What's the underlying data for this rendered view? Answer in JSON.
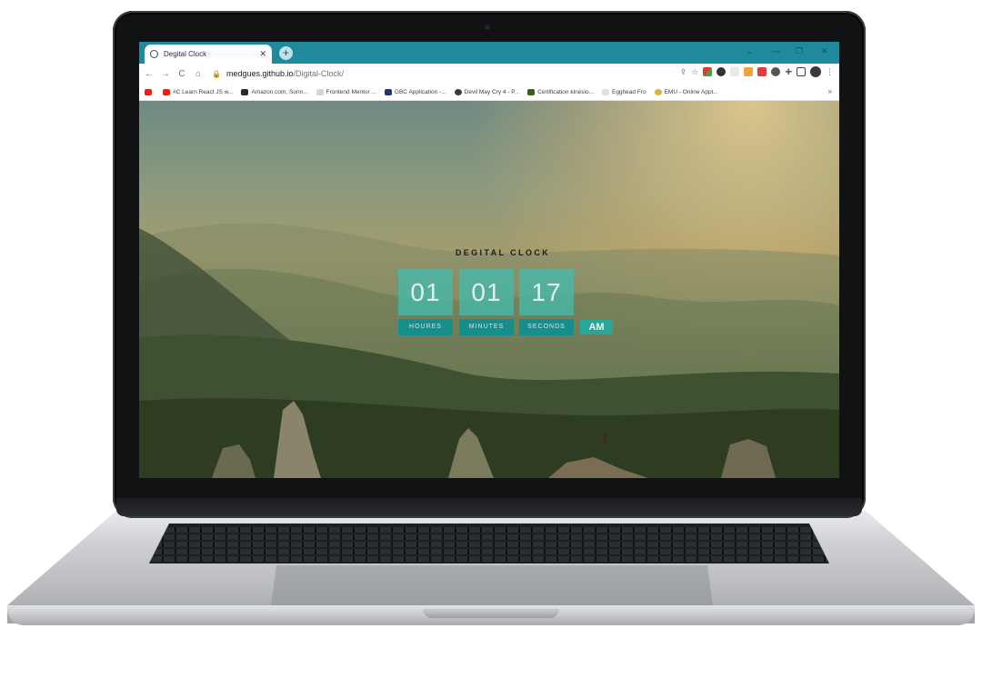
{
  "browser": {
    "tab_title": "Degital Clock",
    "tab_close": "✕",
    "new_tab": "+",
    "window_controls": [
      "⌄",
      "—",
      "❐",
      "✕"
    ],
    "nav": {
      "back": "←",
      "forward": "→",
      "reload": "C",
      "home": "⌂"
    },
    "address": {
      "lock": "🔒",
      "host": "medgues.github.io",
      "path": "/Digital-Clock/"
    },
    "toolbar_icons": [
      "share-icon",
      "star-icon",
      "extension-icons",
      "puzzle-icon",
      "sidebar-icon",
      "profile-avatar",
      "menu-icon"
    ],
    "menu_glyph": "⋮",
    "star_glyph": "☆",
    "bookmarks": [
      {
        "label": "",
        "color": "#e62117"
      },
      {
        "label": "#C Learn React JS w...",
        "color": "#e62117"
      },
      {
        "label": "Amazon.com. Sonn...",
        "color": "#2a2a2a"
      },
      {
        "label": "Frontend Mentor ...",
        "color": "#d5d5d5"
      },
      {
        "label": "GBC Application -...",
        "color": "#22356b"
      },
      {
        "label": "Devil May Cry 4 - P...",
        "color": "#3b3b3b"
      },
      {
        "label": "Certification kinésio...",
        "color": "#3b5e1c"
      },
      {
        "label": "Egghead Fro",
        "color": "#e0e0e0"
      },
      {
        "label": "EMU - Online Appl...",
        "color": "#d8b43a"
      }
    ],
    "bookmarks_more": "»"
  },
  "page": {
    "title": "DEGITAL CLOCK",
    "hours": "01",
    "minutes": "01",
    "seconds": "17",
    "hours_label": "HOURES",
    "minutes_label": "MINUTES",
    "seconds_label": "SECONDS",
    "period": "AM"
  },
  "colors": {
    "tab_strip": "#1e8a9c",
    "tile": "#40beb0",
    "label": "#168e8c",
    "period": "#27a797"
  }
}
